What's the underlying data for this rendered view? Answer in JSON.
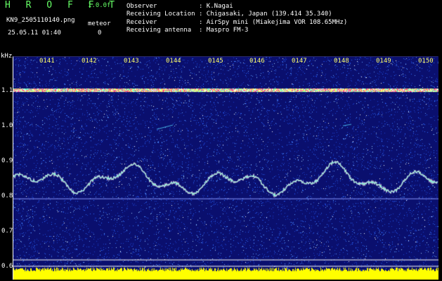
{
  "header": {
    "app_name": "H R O F F T",
    "version": "1.0.0f",
    "filename": "KN9_2505110140.png",
    "meteor_label": "meteor",
    "meteor_count": "0",
    "timestamp": "25.05.11 01:40"
  },
  "info": {
    "observer": "Observer           : K.Nagai",
    "location": "Receiving Location : Chigasaki, Japan (139.414 35.340)",
    "receiver": "Receiver           : AirSpy mini (Miakejima VOR 108.65MHz)",
    "antenna": "Receiving antenna  : Maspro FM-3"
  },
  "axis": {
    "unit": "kHz",
    "y_ticks": [
      "1.1",
      "1.0",
      "0.9",
      "0.8",
      "0.7",
      "0.6"
    ],
    "x_ticks": [
      "0141",
      "0142",
      "0143",
      "0144",
      "0145",
      "0146",
      "0147",
      "0148",
      "0149",
      "0150"
    ]
  },
  "colors": {
    "background": "#000000",
    "spectrogram_base": "#0a0f6e",
    "label_green": "#66ff66",
    "tick_yellow": "#ffff66",
    "noise_band": "#ffff00"
  }
}
